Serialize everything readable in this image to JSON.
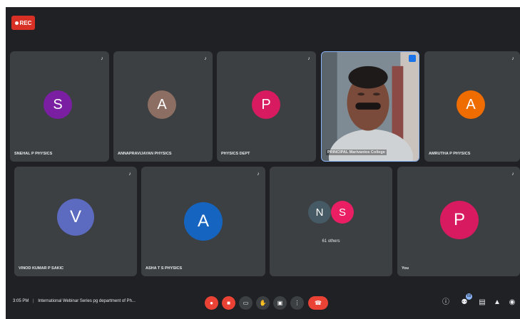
{
  "recording": {
    "label": "REC"
  },
  "participants_row1": [
    {
      "name": "SNEHAL P PHYSICS",
      "initial": "S",
      "color": "#7b1fa2"
    },
    {
      "name": "ANNAPRAVIJAYAN PHYSICS",
      "initial": "A",
      "color": "#8d6e63"
    },
    {
      "name": "PHYSICS DEPT",
      "initial": "P",
      "color": "#d81b60"
    },
    {
      "name": "PRINCIPAL Marivanios College",
      "initial": "",
      "color": "#5d4037"
    },
    {
      "name": "AMRUTHA P PHYSICS",
      "initial": "A",
      "color": "#ef6c00"
    }
  ],
  "participants_row2": [
    {
      "name": "VINOD KUMAR P SAKIC",
      "initial": "V",
      "color": "#5c6bc0"
    },
    {
      "name": "ASHA T S PHYSICS",
      "initial": "A",
      "color": "#1565c0"
    },
    {
      "name": "You",
      "initial": "P",
      "color": "#d81b60"
    }
  ],
  "others_tile": {
    "label": "61 others",
    "initials": [
      "N",
      "S"
    ],
    "colors": [
      "#455a64",
      "#e91e63"
    ]
  },
  "bottom_bar": {
    "time": "3:05 PM",
    "meeting_title": "International Webinar Series pg department of Ph...",
    "people_count": "68"
  },
  "icons": {
    "mic": "mic-off-icon",
    "camera": "camera-off-icon",
    "captions": "captions-icon",
    "raise_hand": "raise-hand-icon",
    "present": "present-screen-icon",
    "more": "more-options-icon",
    "end_call": "end-call-icon",
    "info": "info-icon",
    "people": "people-icon",
    "chat": "chat-icon",
    "activities": "activities-icon",
    "lock": "host-controls-icon"
  }
}
